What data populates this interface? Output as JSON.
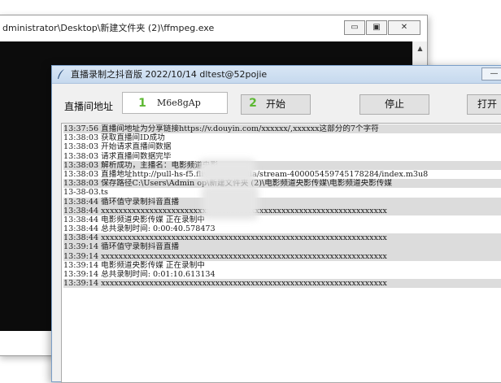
{
  "console": {
    "title": "dministrator\\Desktop\\新建文件夹 (2)\\ffmpeg.exe",
    "btn_minimize": "▭",
    "btn_maximize": "▣",
    "btn_close": "✕"
  },
  "app": {
    "title": "直播录制之抖音版 2022/10/14  dltest@52pojie",
    "url_label": "直播间地址",
    "url_value": "M6e8gAp",
    "step1": "1",
    "step2": "2",
    "start_label": "开始",
    "stop_label": "停止",
    "open_label": "打开"
  },
  "log": [
    "13:37:56 直播间地址为分享链接https://v.douyin.com/xxxxxx/,xxxxxx这部分的7个字符",
    "13:38:03 获取直播间ID成功",
    "13:38:03 开始请求直播间数据",
    "13:38:03 请求直播间数据完毕",
    "13:38:03 解析成功，主播名：电影频道央影",
    "13:38:03 直播地址http://pull-hs-f5.flive.d          m/media/stream-400005459745178284/index.m3u8",
    "13:38:03 保存路径C:\\Users\\Admin              op\\新建文件夹 (2)\\电影频道央影传媒\\电影频道央影传媒",
    "13-38-03.ts",
    "13:38:44 循环值守录制抖音直播",
    "13:38:44 xxxxxxxxxxxxxxxxxxxxxxxxxxxxxxxxxxxxxxxxxxxxxxxxxxxxxxxxxxxxxxxxx",
    "13:38:44 电影频道央影传媒 正在录制中",
    "13:38:44 总共录制时间: 0:00:40.578473",
    "13:38:44 xxxxxxxxxxxxxxxxxxxxxxxxxxxxxxxxxxxxxxxxxxxxxxxxxxxxxxxxxxxxxxxxx",
    "13:39:14 循环值守录制抖音直播",
    "13:39:14 xxxxxxxxxxxxxxxxxxxxxxxxxxxxxxxxxxxxxxxxxxxxxxxxxxxxxxxxxxxxxxxxx",
    "13:39:14 电影频道央影传媒 正在录制中",
    "13:39:14 总共录制时间: 0:01:10.613134",
    "13:39:14 xxxxxxxxxxxxxxxxxxxxxxxxxxxxxxxxxxxxxxxxxxxxxxxxxxxxxxxxxxxxxxxxx"
  ],
  "colors": {
    "step_badge": "#5cb832",
    "log_alt_row": "#dcdcdc",
    "console_bg": "#0c0c0c",
    "titlebar": "#c6d9ee"
  }
}
